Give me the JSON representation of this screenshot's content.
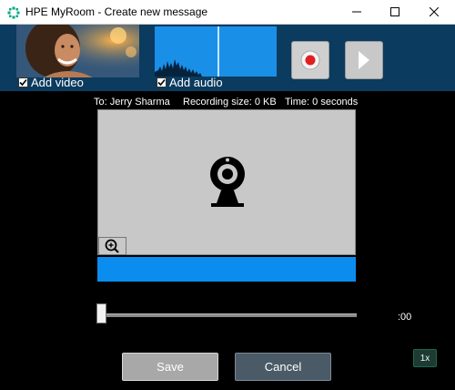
{
  "window": {
    "title": "HPE MyRoom - Create new message",
    "minimize_glyph": "—",
    "maximize_glyph": "☐",
    "close_glyph": "✕"
  },
  "toolbar": {
    "video_checkbox_checked": true,
    "video_label": "Add video",
    "audio_checkbox_checked": true,
    "audio_label": "Add audio",
    "record_icon": "record-icon",
    "play_icon": "play-icon"
  },
  "info": {
    "to": "To: Jerry Sharma",
    "recording_size": "Recording size: 0 KB",
    "time": "Time: 0 seconds"
  },
  "preview": {
    "placeholder_icon": "webcam-icon",
    "zoom_icon": "zoom-in-icon"
  },
  "timeline": {
    "position": 0,
    "time_label": ":00"
  },
  "actions": {
    "save_label": "Save",
    "cancel_label": "Cancel",
    "speed_label": "1x"
  },
  "colors": {
    "toolbar_bg": "#0b3b5e",
    "accent_blue": "#0b8df0",
    "record_red": "#e02020"
  }
}
